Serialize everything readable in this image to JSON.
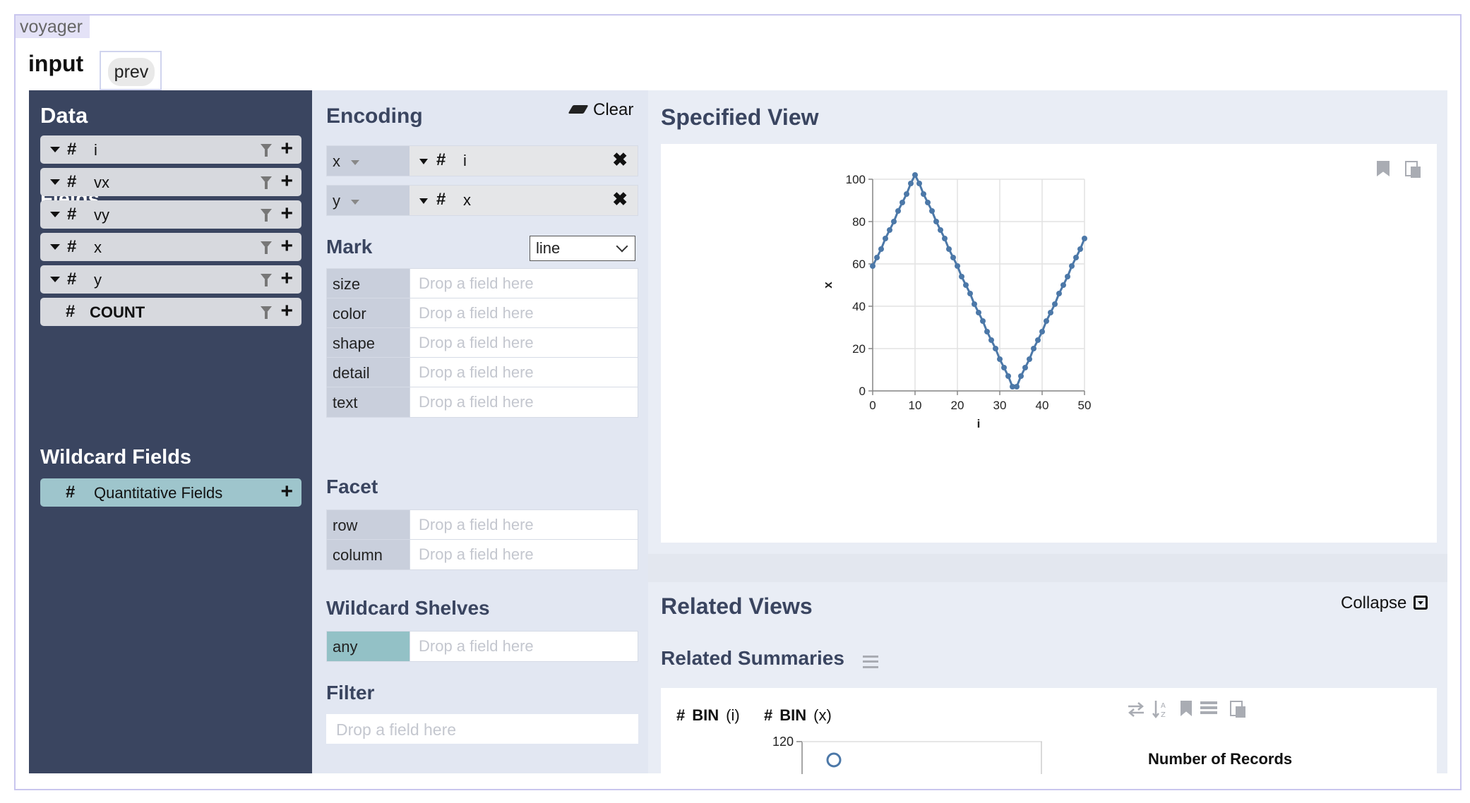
{
  "app": {
    "tag": "voyager",
    "title": "input",
    "prev_label": "prev"
  },
  "data_panel": {
    "title": "Data",
    "fields_title": "Fields",
    "fields": [
      {
        "type": "#",
        "name": "i"
      },
      {
        "type": "#",
        "name": "vx"
      },
      {
        "type": "#",
        "name": "vy"
      },
      {
        "type": "#",
        "name": "x"
      },
      {
        "type": "#",
        "name": "y"
      },
      {
        "type": "#",
        "name": "COUNT"
      }
    ],
    "wildcard_title": "Wildcard Fields",
    "wildcard_field": {
      "type": "#",
      "name": "Quantitative Fields"
    }
  },
  "encoding": {
    "title": "Encoding",
    "clear_label": "Clear",
    "x": {
      "channel": "x",
      "type": "#",
      "field": "i"
    },
    "y": {
      "channel": "y",
      "type": "#",
      "field": "x"
    },
    "mark_title": "Mark",
    "mark_value": "line",
    "drop_placeholder": "Drop a field here",
    "mark_channels": [
      "size",
      "color",
      "shape",
      "detail",
      "text"
    ],
    "facet_title": "Facet",
    "facet_channels": [
      "row",
      "column"
    ],
    "wildcard_title": "Wildcard Shelves",
    "wildcard_channel": "any",
    "filter_title": "Filter"
  },
  "specified_view": {
    "title": "Specified View",
    "chart_data": {
      "type": "line",
      "mark": "line with points",
      "xlabel": "i",
      "ylabel": "x",
      "xlim": [
        0,
        50
      ],
      "ylim": [
        0,
        100
      ],
      "x_ticks": [
        0,
        10,
        20,
        30,
        40,
        50
      ],
      "y_ticks": [
        0,
        20,
        40,
        60,
        80,
        100
      ],
      "grid": true,
      "color": "#4c78a8",
      "x": [
        0,
        1,
        2,
        3,
        4,
        5,
        6,
        7,
        8,
        9,
        10,
        11,
        12,
        13,
        14,
        15,
        16,
        17,
        18,
        19,
        20,
        21,
        22,
        23,
        24,
        25,
        26,
        27,
        28,
        29,
        30,
        31,
        32,
        33,
        34,
        35,
        36,
        37,
        38,
        39,
        40,
        41,
        42,
        43,
        44,
        45,
        46,
        47,
        48,
        49,
        50
      ],
      "values": [
        59,
        63,
        67,
        72,
        76,
        80,
        85,
        89,
        93,
        98,
        102,
        98,
        93,
        89,
        85,
        80,
        76,
        72,
        67,
        63,
        59,
        54,
        50,
        46,
        41,
        37,
        33,
        28,
        24,
        20,
        15,
        11,
        7,
        2,
        2,
        7,
        11,
        15,
        20,
        24,
        28,
        33,
        37,
        41,
        46,
        50,
        54,
        59,
        63,
        67,
        72
      ]
    }
  },
  "related": {
    "title": "Related Views",
    "collapse_label": "Collapse",
    "summaries_title": "Related Summaries",
    "summary_fields": [
      {
        "type": "#",
        "label": "BIN",
        "field": "(i)"
      },
      {
        "type": "#",
        "label": "BIN",
        "field": "(x)"
      }
    ],
    "summary_y_tick": "120",
    "legend_title": "Number of Records"
  }
}
